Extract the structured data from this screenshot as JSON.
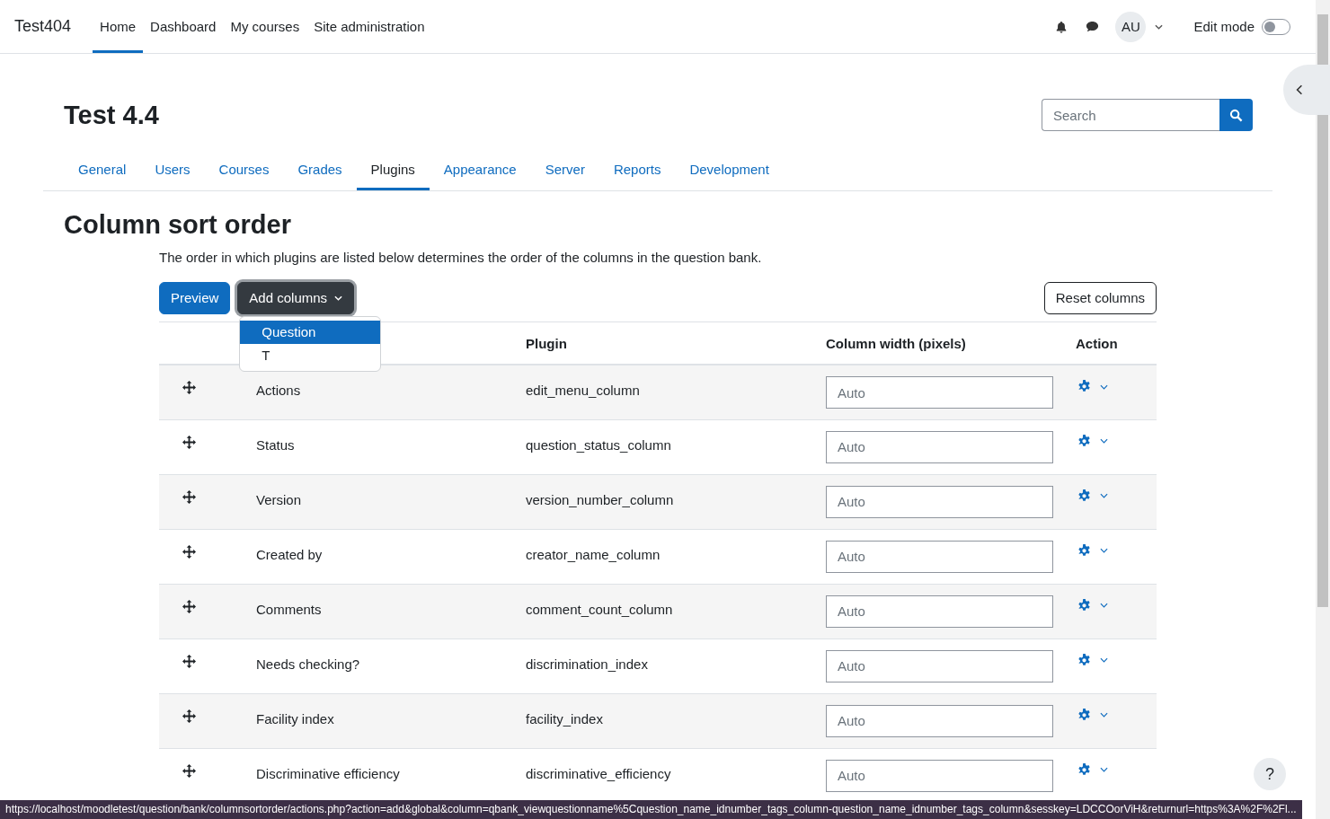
{
  "navbar": {
    "brand": "Test404",
    "items": [
      {
        "label": "Home",
        "selected": true
      },
      {
        "label": "Dashboard",
        "selected": false
      },
      {
        "label": "My courses",
        "selected": false
      },
      {
        "label": "Site administration",
        "selected": false
      }
    ],
    "avatar": "AU",
    "edit_mode": {
      "label": "Edit mode",
      "on": false
    }
  },
  "page_title": "Test 4.4",
  "search": {
    "placeholder": "Search"
  },
  "admin_tabs": [
    {
      "label": "General",
      "selected": false
    },
    {
      "label": "Users",
      "selected": false
    },
    {
      "label": "Courses",
      "selected": false
    },
    {
      "label": "Grades",
      "selected": false
    },
    {
      "label": "Plugins",
      "selected": true
    },
    {
      "label": "Appearance",
      "selected": false
    },
    {
      "label": "Server",
      "selected": false
    },
    {
      "label": "Reports",
      "selected": false
    },
    {
      "label": "Development",
      "selected": false
    }
  ],
  "heading": "Column sort order",
  "description": "The order in which plugins are listed below determines the order of the columns in the question bank.",
  "buttons": {
    "preview": "Preview",
    "add_columns": "Add columns",
    "reset": "Reset columns"
  },
  "add_columns_menu": [
    {
      "label": "Question",
      "selected": true
    },
    {
      "label": "T",
      "selected": false
    }
  ],
  "table": {
    "columns": [
      "Plugin",
      "Column width (pixels)",
      "Action"
    ],
    "rows": [
      {
        "name": "Actions",
        "plugin": "edit_menu_column",
        "width_placeholder": "Auto"
      },
      {
        "name": "Status",
        "plugin": "question_status_column",
        "width_placeholder": "Auto"
      },
      {
        "name": "Version",
        "plugin": "version_number_column",
        "width_placeholder": "Auto"
      },
      {
        "name": "Created by",
        "plugin": "creator_name_column",
        "width_placeholder": "Auto"
      },
      {
        "name": "Comments",
        "plugin": "comment_count_column",
        "width_placeholder": "Auto"
      },
      {
        "name": "Needs checking?",
        "plugin": "discrimination_index",
        "width_placeholder": "Auto"
      },
      {
        "name": "Facility index",
        "plugin": "facility_index",
        "width_placeholder": "Auto"
      },
      {
        "name": "Discriminative efficiency",
        "plugin": "discriminative_efficiency",
        "width_placeholder": "Auto"
      }
    ]
  },
  "help_button": "?",
  "status_url": "https://localhost/moodletest/question/bank/columnsortorder/actions.php?action=add&global&column=qbank_viewquestionname%5Cquestion_name_idnumber_tags_column-question_name_idnumber_tags_column&sesskey=LDCCOorViH&returnurl=https%3A%2F%2Fl..."
}
